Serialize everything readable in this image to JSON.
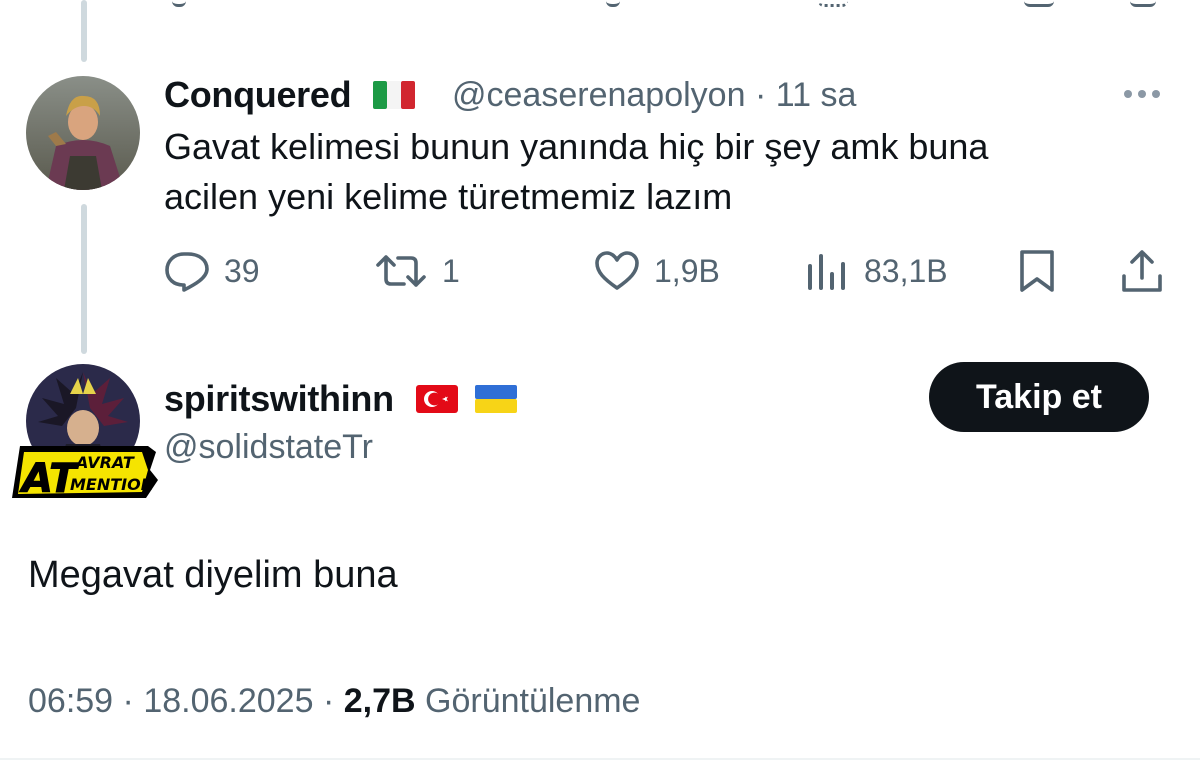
{
  "reply": {
    "display_name": "Conquered",
    "flag_icon": "italy-flag-icon",
    "handle": "@ceaserenapolyon",
    "separator": "·",
    "time_ago": "11 sa",
    "text_line1": "Gavat kelimesi bunun yanında hiç bir şey amk buna",
    "text_line2": "acilen yeni kelime türetmemiz lazım",
    "stats": {
      "replies": "39",
      "reposts": "1",
      "likes": "1,9B",
      "views": "83,1B"
    }
  },
  "main_post": {
    "display_name": "spiritswithinn",
    "flag_icons": [
      "turkey-flag-icon",
      "ukraine-flag-icon"
    ],
    "handle": "@solidstateTr",
    "follow_label": "Takip et",
    "badge_text_top": "AVRAT",
    "badge_text_big": "AT",
    "badge_text_bottom": "MENTION",
    "text": "Megavat diyelim buna",
    "time": "06:59",
    "dot1": "·",
    "date": "18.06.2025",
    "dot2": "·",
    "views_count": "2,7B",
    "views_label": "Görüntülenme"
  },
  "colors": {
    "text": "#0f1419",
    "secondary": "#536471",
    "thread_line": "#cfd9de",
    "button_bg": "#0f1419",
    "badge_yellow": "#f5e400"
  }
}
